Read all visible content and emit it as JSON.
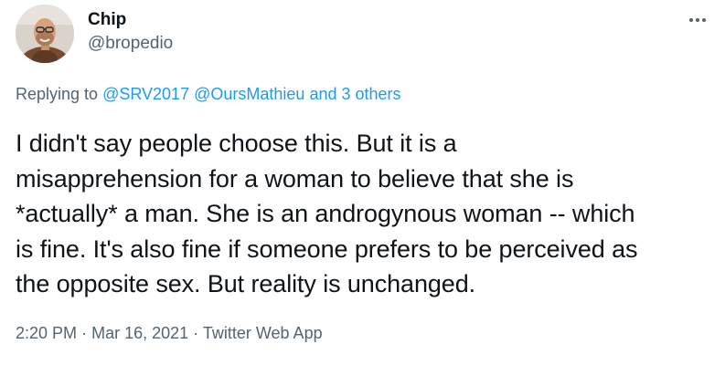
{
  "author": {
    "name": "Chip",
    "handle": "@bropedio",
    "avatar_icon": "user-avatar-photo"
  },
  "more_icon": "more-options-icon",
  "reply_context": {
    "prefix": "Replying to",
    "mention_1": "@SRV2017",
    "mention_2": "@OursMathieu",
    "connector": "and",
    "others": "3 others"
  },
  "tweet": {
    "text": "I didn't say people choose this. But it is a\nmisapprehension for a woman to believe that she is\n*actually* a man. She is an androgynous woman -- which\nis fine. It's also fine if someone prefers to be perceived as\nthe opposite sex. But reality is unchanged."
  },
  "meta": {
    "time": "2:20 PM",
    "separator": "·",
    "date": "Mar 16, 2021",
    "source": "Twitter Web App"
  },
  "colors": {
    "text": "#0f1419",
    "secondary": "#536471",
    "link": "#1d9bf0"
  }
}
